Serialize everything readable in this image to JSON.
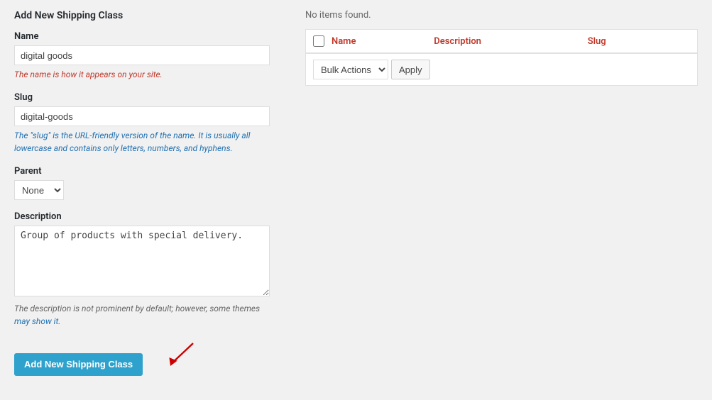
{
  "left_panel": {
    "title": "Add New Shipping Class",
    "name_label": "Name",
    "name_value": "digital goods",
    "name_hint": "The name is how it appears on your site.",
    "slug_label": "Slug",
    "slug_value": "digital-goods",
    "slug_hint": "The \"slug\" is the URL-friendly version of the name. It is usually all lowercase and contains only letters, numbers, and hyphens.",
    "parent_label": "Parent",
    "parent_value": "None",
    "parent_options": [
      "None"
    ],
    "description_label": "Description",
    "description_value": "Group of products with special delivery.",
    "description_hint_prefix": "The description is not prominent by default; however, some themes ",
    "description_hint_link": "may show it.",
    "add_button_label": "Add New Shipping Class"
  },
  "right_panel": {
    "no_items_text": "No items found.",
    "columns": {
      "name": "Name",
      "description": "Description",
      "slug": "Slug"
    },
    "bulk_actions_label": "Bulk Actions",
    "apply_label": "Apply"
  }
}
